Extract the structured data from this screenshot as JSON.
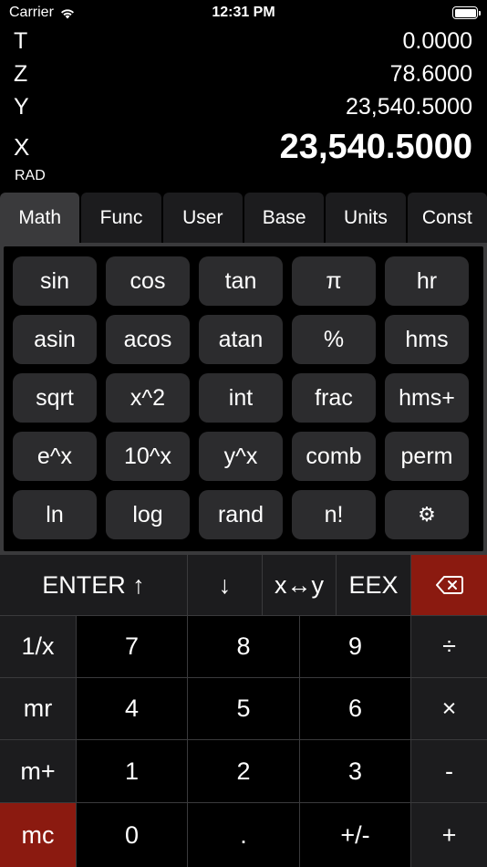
{
  "status_bar": {
    "carrier": "Carrier",
    "time": "12:31 PM",
    "wifi_icon": "wifi-icon",
    "battery_icon": "battery-icon"
  },
  "stack": {
    "t": {
      "label": "T",
      "value": "0.0000"
    },
    "z": {
      "label": "Z",
      "value": "78.6000"
    },
    "y": {
      "label": "Y",
      "value": "23,540.5000"
    },
    "x": {
      "label": "X",
      "value": "23,540.5000"
    }
  },
  "angle_mode": "RAD",
  "tabs": [
    {
      "label": "Math",
      "active": true
    },
    {
      "label": "Func",
      "active": false
    },
    {
      "label": "User",
      "active": false
    },
    {
      "label": "Base",
      "active": false
    },
    {
      "label": "Units",
      "active": false
    },
    {
      "label": "Const",
      "active": false
    }
  ],
  "functions": [
    [
      "sin",
      "cos",
      "tan",
      "π",
      "hr"
    ],
    [
      "asin",
      "acos",
      "atan",
      "%",
      "hms"
    ],
    [
      "sqrt",
      "x^2",
      "int",
      "frac",
      "hms+"
    ],
    [
      "e^x",
      "10^x",
      "y^x",
      "comb",
      "perm"
    ],
    [
      "ln",
      "log",
      "rand",
      "n!",
      "⚙"
    ]
  ],
  "keypad": {
    "enter": "ENTER ↑",
    "roll_down": "↓",
    "swap": "x↔y",
    "eex": "EEX",
    "backspace_icon": "backspace-icon",
    "rows": [
      [
        "1/x",
        "7",
        "8",
        "9",
        "÷"
      ],
      [
        "mr",
        "4",
        "5",
        "6",
        "×"
      ],
      [
        "m+",
        "1",
        "2",
        "3",
        "-"
      ],
      [
        "mc",
        "0",
        ".",
        "+/-",
        "+"
      ]
    ]
  },
  "colors": {
    "background": "#000000",
    "key_dark": "#1c1c1e",
    "key_function": "#2c2c2e",
    "accent_red": "#8b1a10"
  }
}
